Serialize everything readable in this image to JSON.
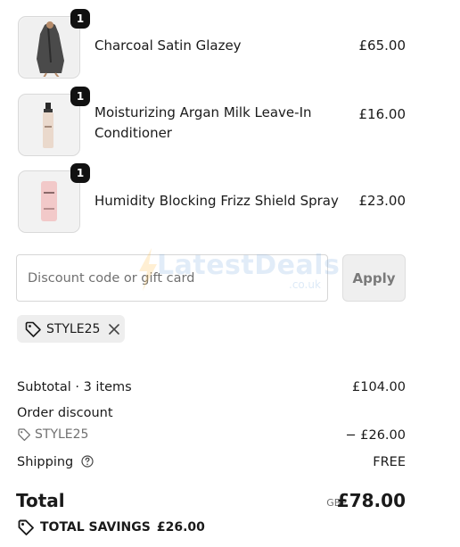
{
  "items": [
    {
      "name": "Charcoal Satin Glazey",
      "price": "£65.00",
      "quantity": "1",
      "image": "robe-photo"
    },
    {
      "name_line1": "Moisturizing Argan Milk Leave-In",
      "name_line2": "Conditioner",
      "price": "£16.00",
      "quantity": "1",
      "image": "spray-bottle-photo"
    },
    {
      "name": "Humidity Blocking Frizz Shield Spray",
      "price": "£23.00",
      "quantity": "1",
      "image": "pink-can-photo"
    }
  ],
  "discount": {
    "placeholder": "Discount code or gift card",
    "apply_label": "Apply",
    "applied_code": "STYLE25"
  },
  "watermark": {
    "brand": "LatestDeals",
    "suffix": ".co.uk"
  },
  "summary": {
    "subtotal_label": "Subtotal · 3 items",
    "subtotal_value": "£104.00",
    "order_discount_label": "Order discount",
    "order_discount_code": "STYLE25",
    "order_discount_value": "− £26.00",
    "shipping_label": "Shipping",
    "shipping_value": "FREE",
    "total_label": "Total",
    "currency": "GBP",
    "total_value": "£78.00",
    "savings_label": "TOTAL SAVINGS",
    "savings_value": "£26.00"
  },
  "colors": {
    "badge": "#111111",
    "tag_bg": "#eeeeee",
    "muted": "#707070",
    "button_bg": "#efefef"
  }
}
